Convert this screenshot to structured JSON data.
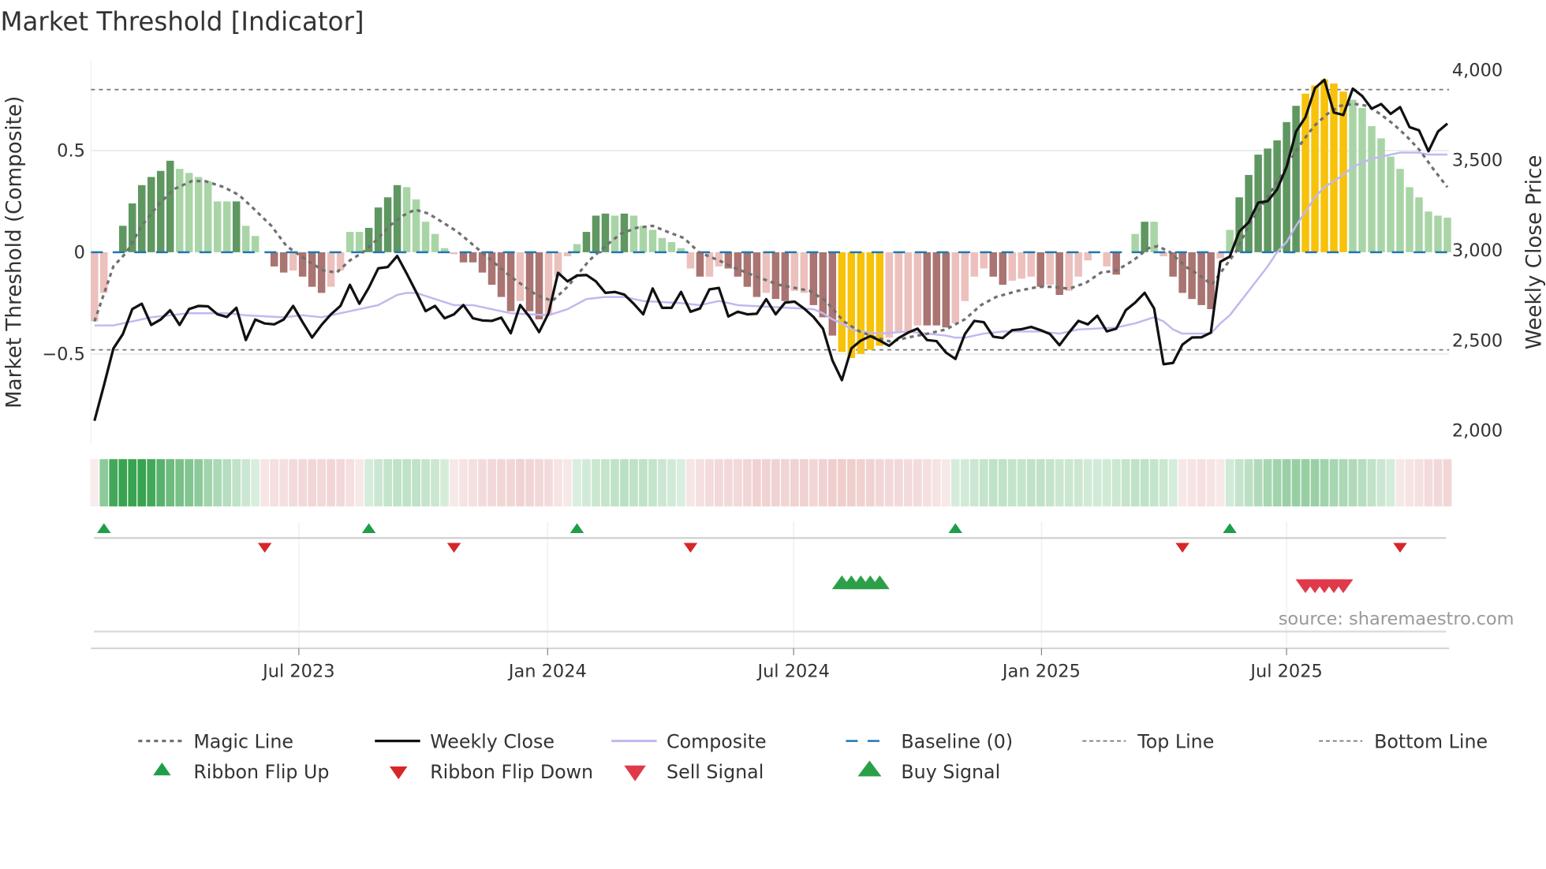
{
  "title": "Market Threshold [Indicator]",
  "source": "source: sharemaestro.com",
  "colors": {
    "hist_dark_green": "#5f9761",
    "hist_light_green": "#a9d5a6",
    "hist_dark_red": "#a97471",
    "hist_light_red": "#ecc0bd",
    "hist_gold": "#f7c20a",
    "weekly_close": "#111111",
    "composite": "#c2b8ee",
    "magic_line": "#707070",
    "baseline": "#1f77b4",
    "threshold_lines": "#777777",
    "ribbon_green": "#2e9e47",
    "ribbon_red": "#d98a8a",
    "flip_up": "#1f9e4a",
    "flip_down": "#d62728",
    "buy": "#2ca048",
    "sell": "#e03a4a"
  },
  "chart_data": {
    "type": "bar",
    "title": "Market Threshold [Indicator]",
    "ylabel_left": "Market Threshold (Composite)",
    "ylabel_right": "Weekly Close Price",
    "ylim_left": [
      -0.94,
      0.94
    ],
    "ylim_right": [
      1930,
      4050
    ],
    "left_ticks": [
      {
        "v": 0.5,
        "label": "0.5"
      },
      {
        "v": 0,
        "label": "0"
      },
      {
        "v": -0.5,
        "label": "−0.5"
      }
    ],
    "right_ticks": [
      {
        "v": 4000,
        "label": "4,000"
      },
      {
        "v": 3500,
        "label": "3,500"
      },
      {
        "v": 3000,
        "label": "3,000"
      },
      {
        "v": 2500,
        "label": "2,500"
      },
      {
        "v": 2000,
        "label": "2,000"
      }
    ],
    "x_ticks": [
      {
        "week": 21.6,
        "label": "Jul 2023"
      },
      {
        "week": 47.9,
        "label": "Jan 2024"
      },
      {
        "week": 73.9,
        "label": "Jul 2024"
      },
      {
        "week": 100.1,
        "label": "Jan 2025"
      },
      {
        "week": 126.0,
        "label": "Jul 2025"
      }
    ],
    "weeks": 144,
    "top_line": 0.8,
    "bottom_line": -0.48,
    "baseline": 0,
    "histogram": [
      -0.34,
      -0.2,
      0,
      0.13,
      0.24,
      0.33,
      0.37,
      0.4,
      0.45,
      0.41,
      0.39,
      0.37,
      0.35,
      0.25,
      0.25,
      0.25,
      0.13,
      0.08,
      0,
      -0.07,
      -0.1,
      -0.09,
      -0.12,
      -0.17,
      -0.2,
      -0.17,
      -0.09,
      0.1,
      0.1,
      0.12,
      0.22,
      0.27,
      0.33,
      0.32,
      0.26,
      0.15,
      0.09,
      0.02,
      -0.01,
      -0.05,
      -0.05,
      -0.1,
      -0.16,
      -0.22,
      -0.29,
      -0.24,
      -0.29,
      -0.33,
      -0.31,
      -0.12,
      -0.02,
      0.04,
      0.1,
      0.18,
      0.19,
      0.18,
      0.19,
      0.18,
      0.13,
      0.11,
      0.07,
      0.05,
      0.02,
      -0.08,
      -0.12,
      -0.12,
      -0.07,
      -0.08,
      -0.12,
      -0.17,
      -0.22,
      -0.2,
      -0.23,
      -0.24,
      -0.19,
      -0.2,
      -0.26,
      -0.32,
      -0.41,
      -0.49,
      -0.52,
      -0.5,
      -0.48,
      -0.46,
      -0.42,
      -0.39,
      -0.39,
      -0.36,
      -0.36,
      -0.36,
      -0.37,
      -0.35,
      -0.24,
      -0.12,
      -0.08,
      -0.12,
      -0.16,
      -0.14,
      -0.13,
      -0.12,
      -0.17,
      -0.16,
      -0.21,
      -0.19,
      -0.12,
      -0.04,
      0,
      -0.07,
      -0.11,
      0,
      0.09,
      0.15,
      0.15,
      -0.02,
      -0.12,
      -0.2,
      -0.23,
      -0.26,
      -0.28,
      -0.03,
      0.11,
      0.27,
      0.38,
      0.48,
      0.51,
      0.55,
      0.64,
      0.72,
      0.78,
      0.82,
      0.85,
      0.83,
      0.79,
      0.75,
      0.71,
      0.62,
      0.56,
      0.47,
      0.41,
      0.32,
      0.27,
      0.2,
      0.18,
      0.17
    ],
    "histogram_style": [
      "lr",
      "lr",
      "lr",
      "dg",
      "dg",
      "dg",
      "dg",
      "dg",
      "dg",
      "lg",
      "lg",
      "lg",
      "lg",
      "lg",
      "lg",
      "dg",
      "lg",
      "lg",
      "lr",
      "dr",
      "dr",
      "lr",
      "dr",
      "dr",
      "dr",
      "lr",
      "lr",
      "lg",
      "lg",
      "dg",
      "dg",
      "dg",
      "dg",
      "lg",
      "lg",
      "lg",
      "lg",
      "lg",
      "lr",
      "dr",
      "dr",
      "dr",
      "dr",
      "dr",
      "dr",
      "lr",
      "dr",
      "dr",
      "lr",
      "lr",
      "lr",
      "lg",
      "dg",
      "dg",
      "dg",
      "lg",
      "dg",
      "lg",
      "lg",
      "lg",
      "lg",
      "lg",
      "lg",
      "lr",
      "dr",
      "lr",
      "lr",
      "dr",
      "dr",
      "dr",
      "dr",
      "lr",
      "dr",
      "dr",
      "lr",
      "lr",
      "dr",
      "dr",
      "dr",
      "gold",
      "gold",
      "gold",
      "gold",
      "gold",
      "lr",
      "lr",
      "lr",
      "lr",
      "dr",
      "dr",
      "dr",
      "lr",
      "lr",
      "lr",
      "lr",
      "dr",
      "dr",
      "lr",
      "lr",
      "lr",
      "dr",
      "lr",
      "dr",
      "lr",
      "lr",
      "lr",
      "lr",
      "lr",
      "dr",
      "lr",
      "lg",
      "dg",
      "lg",
      "lr",
      "dr",
      "dr",
      "dr",
      "dr",
      "dr",
      "lr",
      "lg",
      "dg",
      "dg",
      "dg",
      "dg",
      "dg",
      "dg",
      "dg",
      "gold",
      "gold",
      "gold",
      "gold",
      "gold",
      "lg",
      "lg",
      "lg",
      "lg",
      "lg",
      "lg",
      "lg",
      "lg",
      "lg",
      "lg",
      "lg"
    ],
    "weekly_close": [
      2055,
      2252,
      2456,
      2536,
      2675,
      2704,
      2587,
      2617,
      2668,
      2587,
      2675,
      2692,
      2690,
      2646,
      2631,
      2682,
      2503,
      2617,
      2595,
      2590,
      2617,
      2692,
      2602,
      2517,
      2587,
      2646,
      2692,
      2809,
      2704,
      2794,
      2901,
      2908,
      2969,
      2872,
      2770,
      2663,
      2692,
      2624,
      2646,
      2697,
      2624,
      2612,
      2609,
      2627,
      2541,
      2697,
      2631,
      2547,
      2653,
      2876,
      2828,
      2861,
      2864,
      2828,
      2765,
      2770,
      2755,
      2704,
      2646,
      2789,
      2682,
      2682,
      2770,
      2660,
      2678,
      2784,
      2792,
      2634,
      2660,
      2646,
      2649,
      2730,
      2646,
      2711,
      2716,
      2678,
      2631,
      2566,
      2390,
      2281,
      2456,
      2500,
      2525,
      2500,
      2471,
      2514,
      2544,
      2566,
      2503,
      2497,
      2434,
      2398,
      2536,
      2609,
      2602,
      2522,
      2514,
      2558,
      2563,
      2576,
      2558,
      2536,
      2474,
      2544,
      2609,
      2590,
      2638,
      2551,
      2566,
      2668,
      2711,
      2765,
      2678,
      2369,
      2376,
      2478,
      2517,
      2518,
      2544,
      2937,
      2966,
      3105,
      3156,
      3265,
      3273,
      3338,
      3462,
      3659,
      3739,
      3900,
      3946,
      3765,
      3751,
      3897,
      3856,
      3786,
      3812,
      3757,
      3795,
      3684,
      3666,
      3550,
      3659,
      3703
    ],
    "composite": [
      [
        0,
        -0.36
      ],
      [
        2,
        -0.36
      ],
      [
        4,
        -0.34
      ],
      [
        6,
        -0.32
      ],
      [
        8,
        -0.31
      ],
      [
        10,
        -0.3
      ],
      [
        14,
        -0.3
      ],
      [
        16,
        -0.31
      ],
      [
        20,
        -0.32
      ],
      [
        22,
        -0.31
      ],
      [
        24,
        -0.32
      ],
      [
        26,
        -0.3
      ],
      [
        28,
        -0.28
      ],
      [
        30,
        -0.26
      ],
      [
        32,
        -0.21
      ],
      [
        33,
        -0.2
      ],
      [
        34,
        -0.2
      ],
      [
        36,
        -0.23
      ],
      [
        38,
        -0.26
      ],
      [
        40,
        -0.26
      ],
      [
        44,
        -0.3
      ],
      [
        48,
        -0.31
      ],
      [
        50,
        -0.28
      ],
      [
        52,
        -0.23
      ],
      [
        54,
        -0.22
      ],
      [
        56,
        -0.22
      ],
      [
        58,
        -0.24
      ],
      [
        62,
        -0.25
      ],
      [
        64,
        -0.26
      ],
      [
        66,
        -0.24
      ],
      [
        68,
        -0.26
      ],
      [
        72,
        -0.27
      ],
      [
        76,
        -0.28
      ],
      [
        77,
        -0.3
      ],
      [
        78,
        -0.33
      ],
      [
        79,
        -0.35
      ],
      [
        80,
        -0.38
      ],
      [
        81,
        -0.39
      ],
      [
        83,
        -0.4
      ],
      [
        86,
        -0.39
      ],
      [
        88,
        -0.4
      ],
      [
        90,
        -0.41
      ],
      [
        91,
        -0.42
      ],
      [
        92,
        -0.42
      ],
      [
        94,
        -0.4
      ],
      [
        96,
        -0.39
      ],
      [
        100,
        -0.39
      ],
      [
        102,
        -0.4
      ],
      [
        104,
        -0.38
      ],
      [
        108,
        -0.37
      ],
      [
        110,
        -0.35
      ],
      [
        112,
        -0.32
      ],
      [
        113,
        -0.34
      ],
      [
        114,
        -0.38
      ],
      [
        115,
        -0.4
      ],
      [
        118,
        -0.4
      ],
      [
        119,
        -0.35
      ],
      [
        120,
        -0.31
      ],
      [
        121,
        -0.25
      ],
      [
        122,
        -0.19
      ],
      [
        123,
        -0.13
      ],
      [
        124,
        -0.07
      ],
      [
        125,
        0.0
      ],
      [
        126,
        0.05
      ],
      [
        127,
        0.13
      ],
      [
        128,
        0.2
      ],
      [
        129,
        0.27
      ],
      [
        130,
        0.32
      ],
      [
        131,
        0.35
      ],
      [
        132,
        0.38
      ],
      [
        133,
        0.42
      ],
      [
        134,
        0.44
      ],
      [
        135,
        0.46
      ],
      [
        136,
        0.47
      ],
      [
        137,
        0.48
      ],
      [
        138,
        0.49
      ],
      [
        140,
        0.49
      ],
      [
        141,
        0.48
      ],
      [
        142,
        0.48
      ],
      [
        143,
        0.48
      ]
    ],
    "magic_line": [
      [
        0,
        -0.34
      ],
      [
        2,
        -0.07
      ],
      [
        3.4,
        0
      ],
      [
        5,
        0.13
      ],
      [
        6.7,
        0.23
      ],
      [
        8.4,
        0.31
      ],
      [
        10.3,
        0.35
      ],
      [
        11.7,
        0.35
      ],
      [
        13.7,
        0.32
      ],
      [
        15.3,
        0.28
      ],
      [
        16.7,
        0.22
      ],
      [
        18.7,
        0.13
      ],
      [
        20.3,
        0.03
      ],
      [
        22.8,
        -0.05
      ],
      [
        24.2,
        -0.09
      ],
      [
        25.6,
        -0.1
      ],
      [
        27,
        -0.04
      ],
      [
        28.4,
        0
      ],
      [
        29.8,
        0.06
      ],
      [
        31.2,
        0.13
      ],
      [
        32.6,
        0.18
      ],
      [
        33.9,
        0.21
      ],
      [
        35.3,
        0.19
      ],
      [
        36.7,
        0.15
      ],
      [
        38.4,
        0.1
      ],
      [
        41.2,
        -0.01
      ],
      [
        44,
        -0.12
      ],
      [
        46.7,
        -0.21
      ],
      [
        48.4,
        -0.24
      ],
      [
        50,
        -0.17
      ],
      [
        52.3,
        -0.04
      ],
      [
        54,
        0.03
      ],
      [
        55.6,
        0.09
      ],
      [
        57.3,
        0.12
      ],
      [
        59,
        0.13
      ],
      [
        60.6,
        0.1
      ],
      [
        62.3,
        0.07
      ],
      [
        63.9,
        0
      ],
      [
        66,
        -0.04
      ],
      [
        67.8,
        -0.08
      ],
      [
        70,
        -0.12
      ],
      [
        72.3,
        -0.16
      ],
      [
        74.5,
        -0.18
      ],
      [
        75.6,
        -0.19
      ],
      [
        77.3,
        -0.24
      ],
      [
        79.2,
        -0.34
      ],
      [
        80.9,
        -0.39
      ],
      [
        82.6,
        -0.42
      ],
      [
        84.2,
        -0.44
      ],
      [
        85.9,
        -0.42
      ],
      [
        88.1,
        -0.4
      ],
      [
        90,
        -0.38
      ],
      [
        92,
        -0.33
      ],
      [
        93.7,
        -0.26
      ],
      [
        95.3,
        -0.22
      ],
      [
        97.6,
        -0.19
      ],
      [
        99.8,
        -0.17
      ],
      [
        101.4,
        -0.17
      ],
      [
        103,
        -0.18
      ],
      [
        104.8,
        -0.15
      ],
      [
        106.4,
        -0.1
      ],
      [
        108,
        -0.09
      ],
      [
        109.8,
        -0.04
      ],
      [
        111.4,
        0.02
      ],
      [
        112.4,
        0.03
      ],
      [
        113.7,
        0
      ],
      [
        115.3,
        -0.07
      ],
      [
        116.7,
        -0.11
      ],
      [
        118.1,
        -0.16
      ],
      [
        119.2,
        -0.09
      ],
      [
        120.6,
        0
      ],
      [
        122,
        0.13
      ],
      [
        123.4,
        0.23
      ],
      [
        124.8,
        0.33
      ],
      [
        126.2,
        0.44
      ],
      [
        127.6,
        0.54
      ],
      [
        128.9,
        0.62
      ],
      [
        130.3,
        0.68
      ],
      [
        131.7,
        0.72
      ],
      [
        133.1,
        0.73
      ],
      [
        134.5,
        0.72
      ],
      [
        135.9,
        0.68
      ],
      [
        137.3,
        0.63
      ],
      [
        138.7,
        0.57
      ],
      [
        140.1,
        0.5
      ],
      [
        141.5,
        0.41
      ],
      [
        143,
        0.32
      ]
    ],
    "ribbon": [
      -0.15,
      0.55,
      0.9,
      0.95,
      0.95,
      0.95,
      0.9,
      0.8,
      0.7,
      0.65,
      0.6,
      0.55,
      0.45,
      0.4,
      0.35,
      0.3,
      0.25,
      0.18,
      -0.2,
      -0.25,
      -0.25,
      -0.28,
      -0.3,
      -0.32,
      -0.3,
      -0.32,
      -0.3,
      -0.25,
      -0.18,
      0.2,
      0.25,
      0.28,
      0.3,
      0.3,
      0.3,
      0.28,
      0.25,
      0.2,
      -0.18,
      -0.22,
      -0.25,
      -0.28,
      -0.3,
      -0.32,
      -0.32,
      -0.35,
      -0.33,
      -0.3,
      -0.28,
      -0.22,
      -0.18,
      0.18,
      0.22,
      0.25,
      0.28,
      0.3,
      0.32,
      0.3,
      0.3,
      0.28,
      0.25,
      0.22,
      0.18,
      -0.2,
      -0.25,
      -0.28,
      -0.3,
      -0.3,
      -0.3,
      -0.32,
      -0.35,
      -0.35,
      -0.35,
      -0.33,
      -0.35,
      -0.35,
      -0.32,
      -0.35,
      -0.38,
      -0.38,
      -0.38,
      -0.35,
      -0.35,
      -0.32,
      -0.3,
      -0.3,
      -0.28,
      -0.28,
      -0.25,
      -0.22,
      -0.18,
      0.2,
      0.22,
      0.25,
      0.28,
      0.3,
      0.3,
      0.28,
      0.28,
      0.3,
      0.3,
      0.28,
      0.25,
      0.25,
      0.25,
      0.22,
      0.22,
      0.22,
      0.25,
      0.28,
      0.3,
      0.3,
      0.28,
      0.25,
      0.2,
      -0.18,
      -0.22,
      -0.25,
      -0.22,
      -0.18,
      0.22,
      0.28,
      0.32,
      0.38,
      0.42,
      0.45,
      0.48,
      0.5,
      0.5,
      0.48,
      0.45,
      0.42,
      0.4,
      0.38,
      0.35,
      0.3,
      0.25,
      0.2,
      -0.18,
      -0.22,
      -0.25,
      -0.28,
      -0.3,
      -0.32
    ],
    "ribbon_flip_up": [
      1,
      29,
      51,
      91,
      120
    ],
    "ribbon_flip_down": [
      18,
      38,
      63,
      115,
      138
    ],
    "buy_signals": [
      79,
      80,
      81,
      82,
      83
    ],
    "sell_signals": [
      128,
      129,
      130,
      131,
      132
    ],
    "legend": [
      {
        "key": "magic",
        "label": "Magic Line"
      },
      {
        "key": "close",
        "label": "Weekly Close"
      },
      {
        "key": "composite",
        "label": "Composite"
      },
      {
        "key": "baseline",
        "label": "Baseline (0)"
      },
      {
        "key": "top",
        "label": "Top Line"
      },
      {
        "key": "bottom",
        "label": "Bottom Line"
      },
      {
        "key": "flipup",
        "label": "Ribbon Flip Up"
      },
      {
        "key": "flipdown",
        "label": "Ribbon Flip Down"
      },
      {
        "key": "sell",
        "label": "Sell Signal"
      },
      {
        "key": "buy",
        "label": "Buy Signal"
      }
    ]
  }
}
